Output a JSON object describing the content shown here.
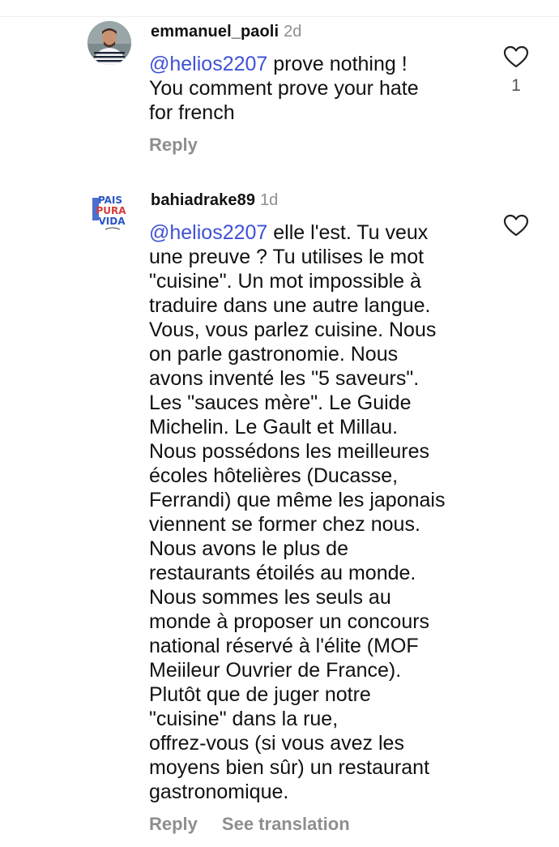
{
  "comments": [
    {
      "username": "emmanuel_paoli",
      "time": "2d",
      "mention": "@helios2207",
      "first_line_rest": " prove nothing !",
      "lines": [
        "You comment prove your hate",
        "for french"
      ],
      "like_count": "1",
      "reply_label": "Reply",
      "avatar_icon": "profile-photo"
    },
    {
      "username": "bahiadrake89",
      "time": "1d",
      "mention": "@helios2207",
      "first_line_rest": " elle l'est. Tu veux",
      "lines": [
        "une preuve ? Tu utilises le mot",
        "\"cuisine\". Un mot impossible à",
        "traduire dans une autre langue.",
        "Vous, vous parlez cuisine. Nous",
        "on parle gastronomie. Nous",
        "avons inventé les \"5 saveurs\".",
        "Les \"sauces mère\". Le Guide",
        "Michelin. Le Gault et Millau.",
        "Nous possédons les meilleures",
        "écoles hôtelières (Ducasse,",
        "Ferrandi) que même les japonais",
        "viennent se former chez nous.",
        "Nous avons le plus de",
        "restaurants étoilés au monde.",
        "Nous sommes les seuls au",
        "monde à proposer un concours",
        "national réservé à l'élite (MOF",
        "Meiileur Ouvrier de France).",
        "Plutôt que de juger notre",
        "\"cuisine\" dans la rue,",
        "offrez-vous (si vous avez les",
        "moyens bien sûr) un restaurant",
        "gastronomique."
      ],
      "reply_label": "Reply",
      "see_translation_label": "See translation",
      "avatar_text": [
        "PAIS",
        "PURA",
        "VIDA"
      ],
      "avatar_icon": "pura-vida-logo"
    }
  ],
  "colors": {
    "mention": "#3f51d6",
    "muted": "#8e8e8e",
    "text": "#111111"
  }
}
